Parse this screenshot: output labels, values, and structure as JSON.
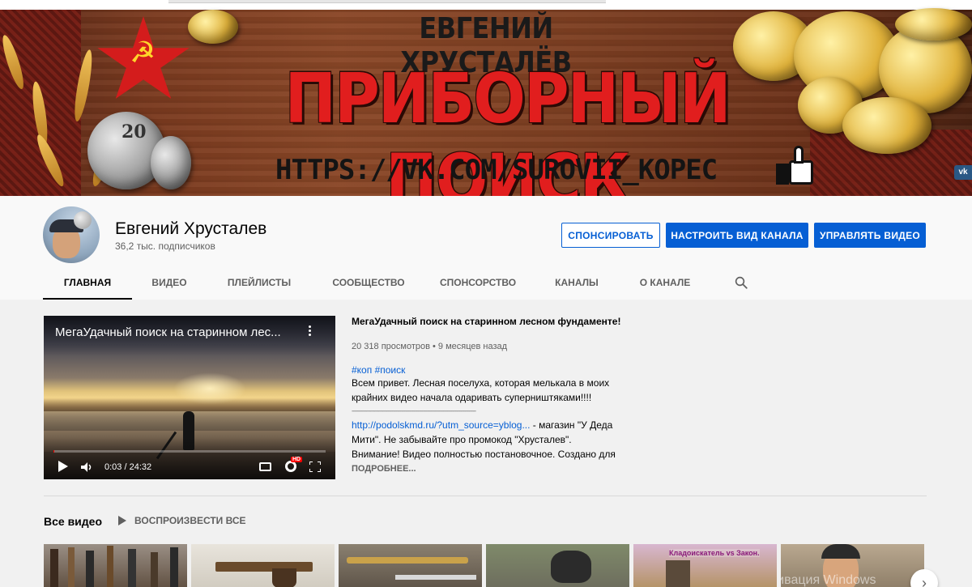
{
  "banner": {
    "name": "ЕВГЕНИЙ ХРУСТАЛЁВ",
    "title": "ПРИБОРНЫЙ ПОИСК",
    "url": "HTTPS://VK.COM/SUROVII_KOPEC",
    "coin_text": "20",
    "vk_label": "vk"
  },
  "channel": {
    "name": "Евгений Хрусталев",
    "subscribers": "36,2 тыс. подписчиков",
    "buttons": {
      "sponsor": "СПОНСИРОВАТЬ",
      "customize": "НАСТРОИТЬ ВИД КАНАЛА",
      "manage": "УПРАВЛЯТЬ ВИДЕО"
    }
  },
  "tabs": [
    {
      "label": "ГЛАВНАЯ"
    },
    {
      "label": "ВИДЕО"
    },
    {
      "label": "ПЛЕЙЛИСТЫ"
    },
    {
      "label": "СООБЩЕСТВО"
    },
    {
      "label": "СПОНСОРСТВО"
    },
    {
      "label": "КАНАЛЫ"
    },
    {
      "label": "О КАНАЛЕ"
    }
  ],
  "featured": {
    "player_title": "МегаУдачный поиск на старинном лес...",
    "time": "0:03 / 24:32",
    "hd": "HD",
    "progress": 0.002,
    "title": "МегаУдачный поиск на старинном лесном фундаменте!",
    "meta": "20 318 просмотров • 9 месяцев назад",
    "tags": "#коп #поиск",
    "desc1": "Всем привет. Лесная поселуха, которая мелькала в моих крайних видео начала одаривать суперништяками!!!!",
    "separator": "--------------------------------------------------------------------------------------------",
    "link": "http://podolskmd.ru/?utm_source=yblog...",
    "desc2": " - магазин \"У Деда Мити\". Не забывайте про промокод \"Хрусталев\".",
    "desc3": "Внимание! Видео полностью постановочное. Создано для",
    "more": "ПОДРОБНЕЕ..."
  },
  "all_videos": {
    "title": "Все видео",
    "play_all": "ВОСПРОИЗВЕСТИ ВСЕ",
    "thumb5_text": "Кладоискатель vs Закон.",
    "watermark": "Активация Windows"
  },
  "colors": {
    "accent": "#065fd4",
    "text": "#030303",
    "secondary": "#606060",
    "banner_red": "#e11e1e"
  }
}
